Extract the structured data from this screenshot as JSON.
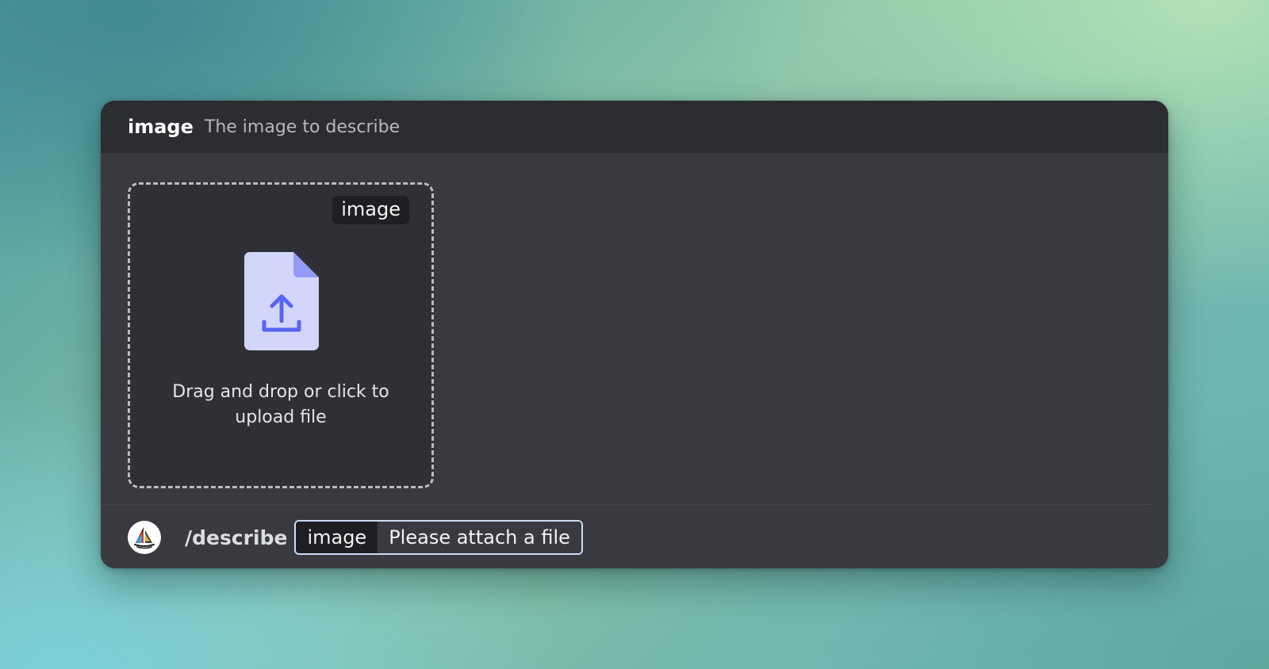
{
  "option": {
    "name": "image",
    "description": "The image to describe"
  },
  "upload": {
    "tag": "image",
    "prompt": "Drag and drop or click to upload file",
    "icon": "file-upload-icon"
  },
  "command": {
    "name": "/describe",
    "avatar_icon": "sailboat-logo-icon",
    "param_key": "image",
    "param_value": "Please attach a file"
  },
  "colors": {
    "panel": "#393a40",
    "header": "#2c2d31",
    "file_icon_fill": "#d3d6fb",
    "file_icon_accent": "#5865f2",
    "chip_border": "#c9dcf5"
  }
}
